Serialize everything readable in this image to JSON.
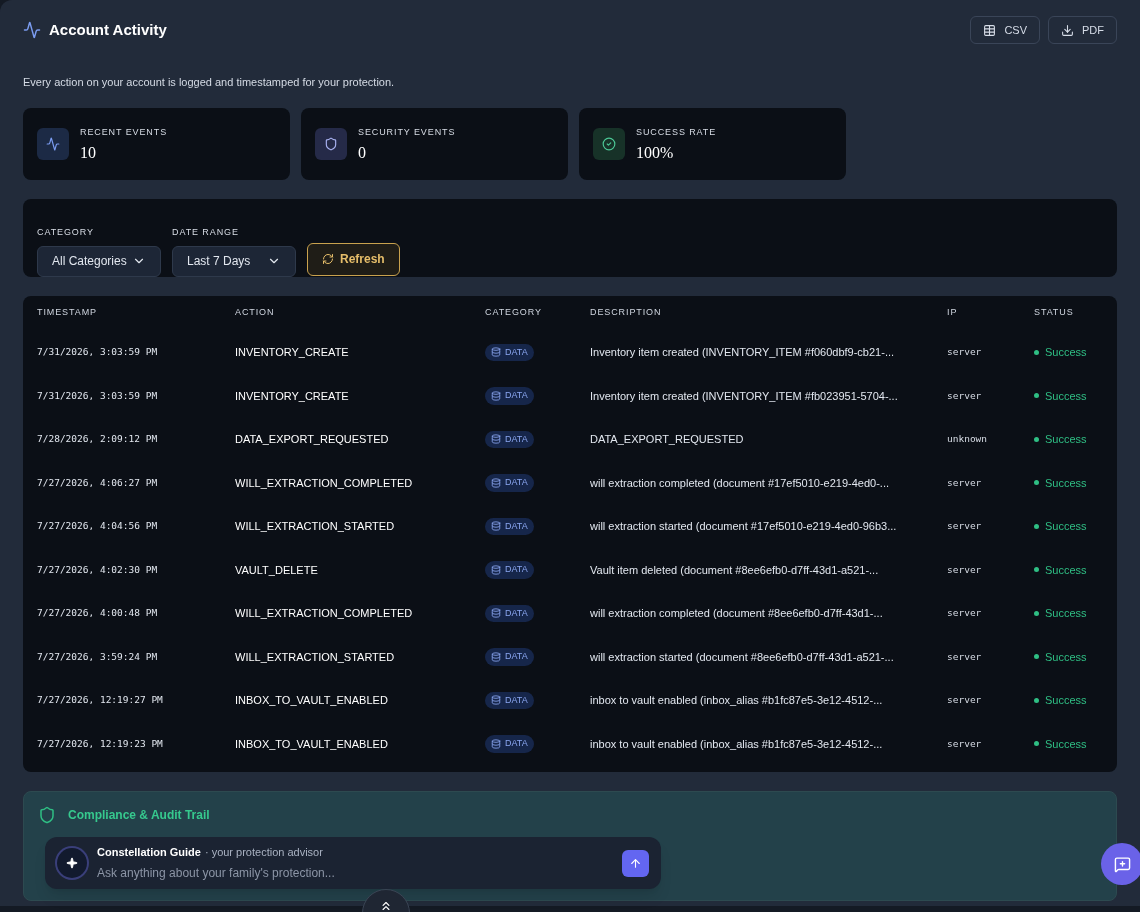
{
  "header": {
    "title": "Account Activity",
    "buttons": [
      {
        "kind": "csv",
        "label": "CSV"
      },
      {
        "kind": "pdf",
        "label": "PDF"
      }
    ]
  },
  "description": "Every action on your account is logged and timestamped for your protection.",
  "stats": [
    {
      "kind": "activity",
      "label": "RECENT EVENTS",
      "value": "10"
    },
    {
      "kind": "security",
      "label": "SECURITY EVENTS",
      "value": "0"
    },
    {
      "kind": "success",
      "label": "SUCCESS RATE",
      "value": "100%"
    }
  ],
  "filters": [
    {
      "label": "CATEGORY",
      "value": "All Categories"
    },
    {
      "label": "DATE RANGE",
      "value": "Last 7 Days"
    }
  ],
  "refresh": "Refresh",
  "table": {
    "columns": [
      "TIMESTAMP",
      "ACTION",
      "CATEGORY",
      "DESCRIPTION",
      "IP",
      "STATUS"
    ],
    "rows": [
      {
        "timestamp": "7/31/2026, 3:03:59 PM",
        "action": "INVENTORY_CREATE",
        "category": "DATA",
        "description": "Inventory item created (INVENTORY_ITEM #f060dbf9-cb21-...",
        "ip": "server",
        "status": "Success"
      },
      {
        "timestamp": "7/31/2026, 3:03:59 PM",
        "action": "INVENTORY_CREATE",
        "category": "DATA",
        "description": "Inventory item created (INVENTORY_ITEM #fb023951-5704-...",
        "ip": "server",
        "status": "Success"
      },
      {
        "timestamp": "7/28/2026, 2:09:12 PM",
        "action": "DATA_EXPORT_REQUESTED",
        "category": "DATA",
        "description": "DATA_EXPORT_REQUESTED",
        "ip": "unknown",
        "status": "Success"
      },
      {
        "timestamp": "7/27/2026, 4:06:27 PM",
        "action": "WILL_EXTRACTION_COMPLETED",
        "category": "DATA",
        "description": "will extraction completed (document #17ef5010-e219-4ed0-...",
        "ip": "server",
        "status": "Success"
      },
      {
        "timestamp": "7/27/2026, 4:04:56 PM",
        "action": "WILL_EXTRACTION_STARTED",
        "category": "DATA",
        "description": "will extraction started (document #17ef5010-e219-4ed0-96b3...",
        "ip": "server",
        "status": "Success"
      },
      {
        "timestamp": "7/27/2026, 4:02:30 PM",
        "action": "VAULT_DELETE",
        "category": "DATA",
        "description": "Vault item deleted (document #8ee6efb0-d7ff-43d1-a521-...",
        "ip": "server",
        "status": "Success"
      },
      {
        "timestamp": "7/27/2026, 4:00:48 PM",
        "action": "WILL_EXTRACTION_COMPLETED",
        "category": "DATA",
        "description": "will extraction completed (document #8ee6efb0-d7ff-43d1-...",
        "ip": "server",
        "status": "Success"
      },
      {
        "timestamp": "7/27/2026, 3:59:24 PM",
        "action": "WILL_EXTRACTION_STARTED",
        "category": "DATA",
        "description": "will extraction started (document #8ee6efb0-d7ff-43d1-a521-...",
        "ip": "server",
        "status": "Success"
      },
      {
        "timestamp": "7/27/2026, 12:19:27 PM",
        "action": "INBOX_TO_VAULT_ENABLED",
        "category": "DATA",
        "description": "inbox to vault enabled (inbox_alias #b1fc87e5-3e12-4512-...",
        "ip": "server",
        "status": "Success"
      },
      {
        "timestamp": "7/27/2026, 12:19:23 PM",
        "action": "INBOX_TO_VAULT_ENABLED",
        "category": "DATA",
        "description": "inbox to vault enabled (inbox_alias #b1fc87e5-3e12-4512-...",
        "ip": "server",
        "status": "Success"
      }
    ]
  },
  "compliance": {
    "title": "Compliance & Audit Trail"
  },
  "chat": {
    "name": "Constellation Guide",
    "subtitle": "· your protection advisor",
    "placeholder": "Ask anything about your family's protection..."
  }
}
